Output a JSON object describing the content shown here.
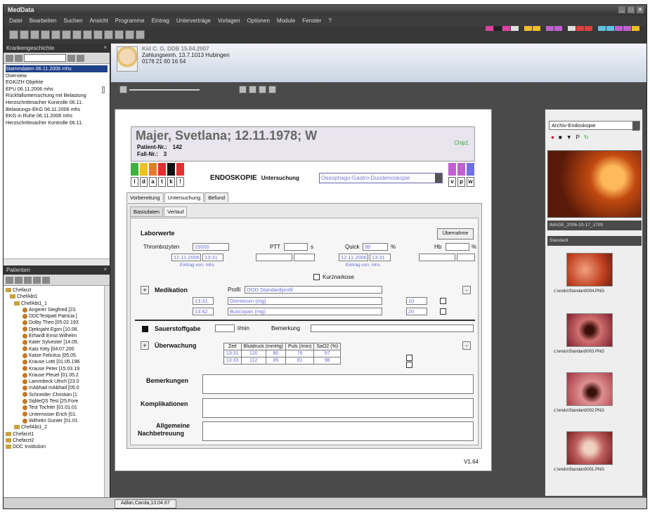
{
  "app": {
    "title": "MedData"
  },
  "menu": [
    "Datei",
    "Bearbeiten",
    "Suchen",
    "Ansicht",
    "Programme",
    "Eintrag",
    "Unterverträge",
    "Vorlagen",
    "Optionen",
    "Module",
    "Fenster",
    "?"
  ],
  "history": {
    "title": "Krankengeschichte",
    "items": [
      "Stammdaten 06.11.2006 mhs",
      "Overview",
      "EGK/ZH Objekte",
      "EPU 06.11.2006 mhs",
      "Rückfalluntersuchung mit Belastung",
      "Herzschrittmacher Kontrolle 06.11.",
      "Belastungs-EKG 06.11.2006 mhs",
      "EKG in Ruhe 06.11.2006 mhs",
      "Herzschrittmacher Kontrolle 06.11."
    ]
  },
  "patients": {
    "title": "Patienten",
    "items": [
      "Chefarzt",
      "ChefAbt1",
      "ChefAbt1_1",
      "Angerer Siegfried [23.",
      "DDCTestpatt Patricia [",
      "Dolby Theo [05.02.193",
      "Djeksjaht Egon [10.08.",
      "Erhardt Ernst Wilhelm",
      "Kater Sylvester [14.05.",
      "Katz Kitty [04.07.200",
      "Katze Felicitus [05.05.",
      "Krause Lotti [01.05.196",
      "Krause Peter [15.03.19",
      "Krause Pleuel [01.05.2",
      "Lammbeck Ulrich [23.0",
      "mAbhad mAbhad [05.0",
      "Schneider Christian [1",
      "SqliteQS Test [25.Fore",
      "Test Tochter [01.01.01",
      "Untermoser Erich [01.",
      "Wilhelm Gunter [01.01",
      "ChefAbt1_2",
      "Chefarzt1",
      "Chefarzt2",
      "DDC Institution"
    ]
  },
  "header": {
    "name": "Kid C. G. DDB 15.04.2007",
    "line2": "Zahlungseinh. 13.7.1013 Hubingen",
    "line3": "0176 21 60 16 54"
  },
  "patient": {
    "name": "Majer, Svetlana; 12.11.1978; W",
    "patient_nr_label": "Patient-Nr.:",
    "patient_nr": "142",
    "fall_nr_label": "Fall-Nr.:",
    "fall_nr": "3",
    "chip": "Chip1"
  },
  "flags": [
    "i",
    "d",
    "a",
    "t",
    "k",
    "!"
  ],
  "flags_right": [
    "v",
    "p",
    "w"
  ],
  "exam": {
    "title": "ENDOSKOPIE",
    "label": "Untersuchung",
    "value": "Oesophago-Gastro-Duodenoskopie"
  },
  "tabs": [
    "Vorbereitung",
    "Untersuchung",
    "Befund"
  ],
  "subtabs": [
    "Basisdaten",
    "Verlauf"
  ],
  "labor": {
    "title": "Laborwerte",
    "button": "Übernahme",
    "thrombo_label": "Thrombozyten",
    "thrombo_value": "15000",
    "thrombo_date": "12.11.2006",
    "thrombo_time": "13:31",
    "thrombo_sub": "Eintrag von: mhs",
    "ptt_label": "PTT",
    "ptt_unit": "s",
    "quick_label": "Quick",
    "quick_value": "99",
    "quick_unit": "%",
    "quick_date": "12.11.2006",
    "quick_time": "13:31",
    "quick_sub": "Eintrag von: mhs",
    "hb_label": "Hb",
    "hb_unit": "%",
    "kurznarkose": "Kurznarkose"
  },
  "medikation": {
    "title": "Medikation",
    "profil_label": "Profil",
    "profil_value": "OGD Standardprofil",
    "rows": [
      {
        "time": "13:31",
        "drug": "Dormicum (mg)",
        "dose": "10"
      },
      {
        "time": "13:42",
        "drug": "Buscopan (mg)",
        "dose": "20"
      }
    ]
  },
  "sauerstoff": {
    "label": "Sauerstoffgabe",
    "unit": "l/min",
    "bem_label": "Bemerkung"
  },
  "ueberwachung": {
    "title": "Überwachung",
    "headers": [
      "Zeit",
      "Blutdruck (mmHg)",
      "Puls (/min)",
      "SaO2 (%)"
    ],
    "rows": [
      [
        "13:31",
        "120",
        "80",
        "76",
        "97"
      ],
      [
        "13:33",
        "112",
        "85",
        "81",
        "98"
      ]
    ]
  },
  "bemerkungen": "Bemerkungen",
  "komplikationen": "Komplikationen",
  "allgemeine": "Allgemeine",
  "nachbetreuung": "Nachbetreuung",
  "version": "V1.64",
  "archive": {
    "selector": "Archiv-Endoskopie",
    "image_label": "IMAGE_2006-10-17_1709",
    "standard": "Standard",
    "thumbs": [
      "c:\\endo\\Standard\\004.PNG",
      "c:\\endo\\Standard\\003.PNG",
      "c:\\endo\\Standard\\002.PNG",
      "c:\\endo\\Standard\\001.PNG"
    ]
  },
  "status": {
    "tab": "Adlan,Carola,13.04.67"
  },
  "colors": {
    "accent": "#1e3f8a",
    "field_text": "#6a6ad8"
  }
}
